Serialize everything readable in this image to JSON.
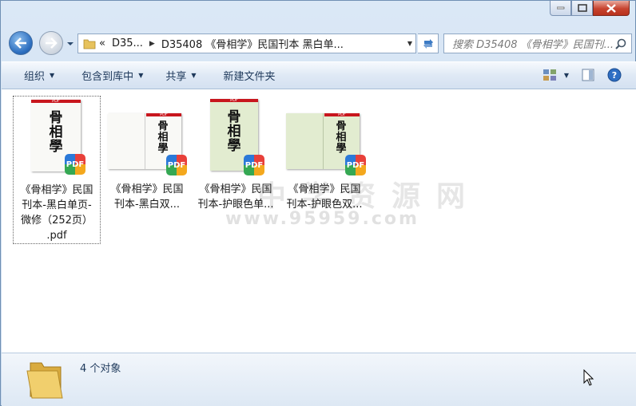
{
  "window": {
    "caption_buttons": [
      "minimize",
      "maximize",
      "close"
    ]
  },
  "nav": {
    "address_crumbs": [
      "D35...",
      "D35408 《骨相学》民国刊本 黑白单..."
    ],
    "address_prefix": "«",
    "search_placeholder": "搜索 D35408 《骨相学》民国刊..."
  },
  "toolbar": {
    "organize": "组织",
    "include_in_library": "包含到库中",
    "share": "共享",
    "new_folder": "新建文件夹"
  },
  "files": [
    {
      "label_lines": [
        "《骨相学》民国",
        "刊本-黑白单页-",
        "微修（252页）",
        ".pdf"
      ],
      "thumb": "single-white",
      "selected": true
    },
    {
      "label_lines": [
        "《骨相学》民国",
        "刊本-黑白双..."
      ],
      "thumb": "double-white",
      "selected": false
    },
    {
      "label_lines": [
        "《骨相学》民国",
        "刊本-护眼色单..."
      ],
      "thumb": "single-green",
      "selected": false
    },
    {
      "label_lines": [
        "《骨相学》民国",
        "刊本-护眼色双..."
      ],
      "thumb": "double-green",
      "selected": false
    }
  ],
  "thumbnail_text": {
    "seal_chars": [
      "骨",
      "相",
      "學"
    ],
    "pdf_tag": "PDF",
    "badge": "PDF"
  },
  "watermark": {
    "line1": "中学资源网",
    "line2": "www.95959.com"
  },
  "status": {
    "count": "4 个对象"
  },
  "colors": {
    "accent": "#1e395b",
    "pdf_bar": "#c8161d",
    "eye_care_green": "#e2ecd0"
  }
}
